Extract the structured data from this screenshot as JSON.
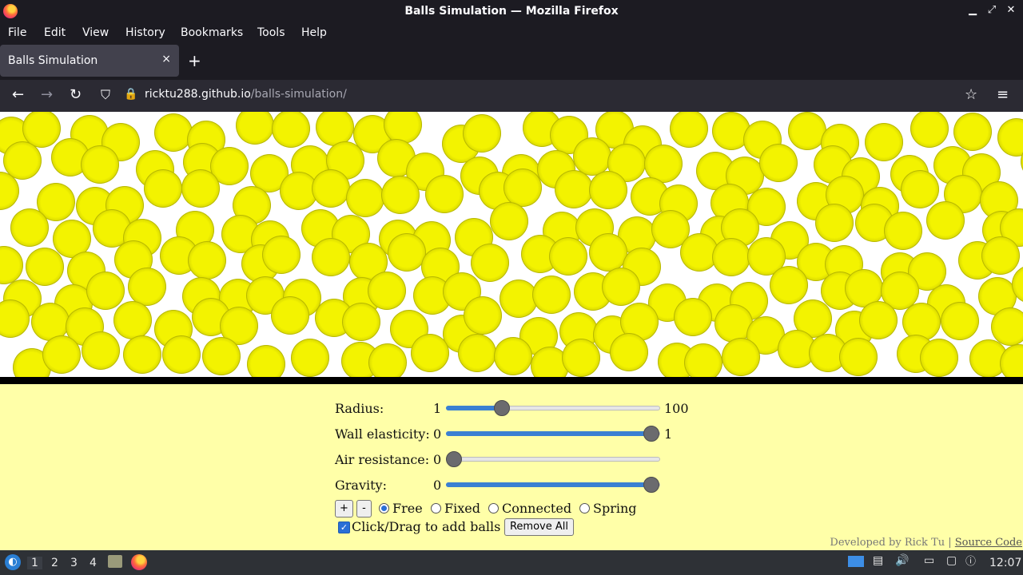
{
  "window": {
    "title": "Balls Simulation — Mozilla Firefox"
  },
  "menu": [
    "File",
    "Edit",
    "View",
    "History",
    "Bookmarks",
    "Tools",
    "Help"
  ],
  "tab": {
    "label": "Balls Simulation",
    "close": "×",
    "new": "+"
  },
  "nav": {
    "url_host": "ricktu288.github.io",
    "url_path": "/balls-simulation/"
  },
  "controls": {
    "radius": {
      "label": "Radius:",
      "min": "1",
      "max": "100",
      "value": 24
    },
    "elasticity": {
      "label": "Wall elasticity:",
      "min": "0",
      "max": "1",
      "value": 1
    },
    "air": {
      "label": "Air resistance:",
      "min": "0",
      "value": 0
    },
    "gravity": {
      "label": "Gravity:",
      "min": "0",
      "value": 1
    },
    "plus": "+",
    "minus": "-",
    "modes": [
      "Free",
      "Fixed",
      "Connected",
      "Spring"
    ],
    "selected_mode": "Free",
    "click_drag_label": "Click/Drag to add balls",
    "click_drag_checked": true,
    "remove_all": "Remove All"
  },
  "footer": {
    "developed": "Developed by Rick Tu",
    "sep": "|",
    "source": "Source Code"
  },
  "taskbar": {
    "workspaces": [
      "1",
      "2",
      "3",
      "4"
    ],
    "active_workspace": "1",
    "clock": "12:07"
  },
  "colors": {
    "ball": "#e6e600",
    "panel": "#ffffa8",
    "accent": "#3a80d2"
  }
}
